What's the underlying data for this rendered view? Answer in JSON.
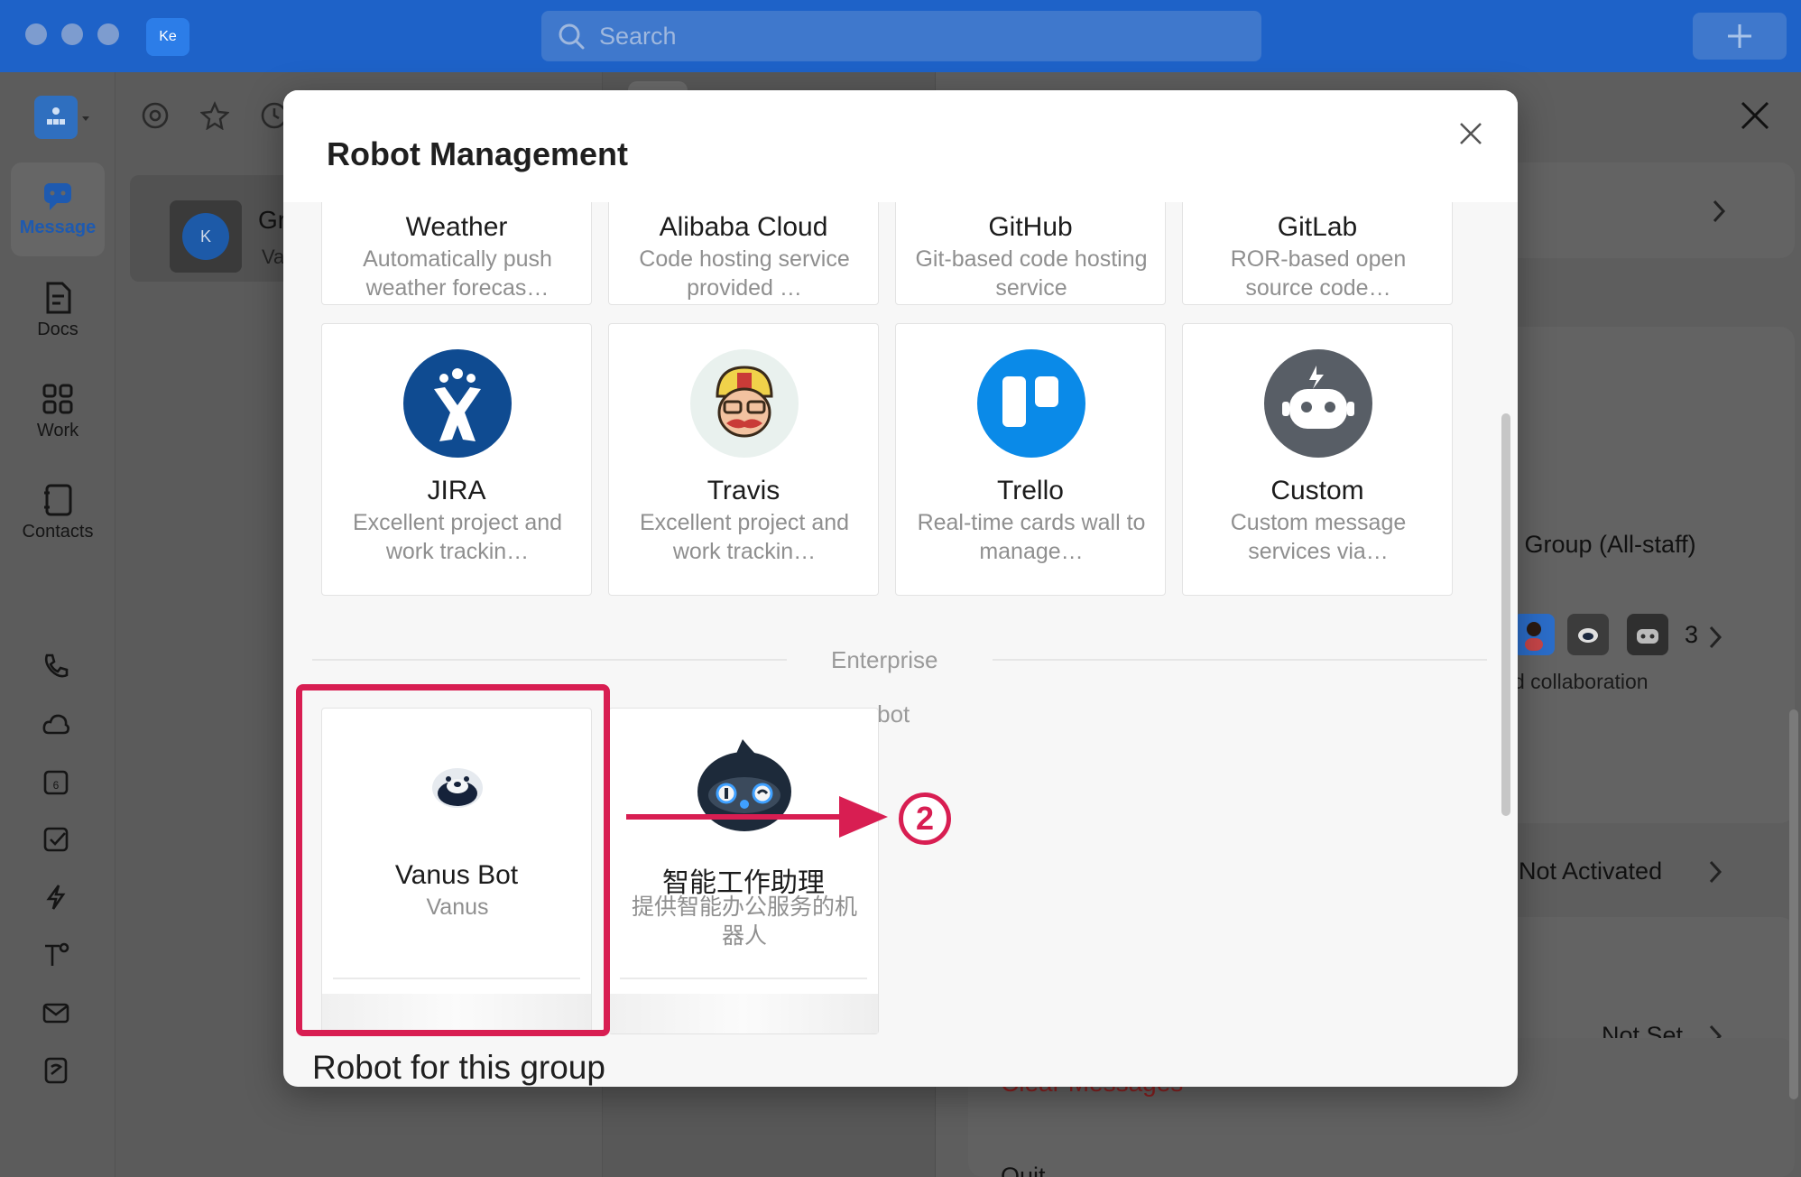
{
  "titlebar": {
    "app_badge": "Ke",
    "search_placeholder": "Search"
  },
  "sidebar": {
    "items": [
      {
        "label": "Message",
        "active": true
      },
      {
        "label": "Docs"
      },
      {
        "label": "Work"
      },
      {
        "label": "Contacts"
      }
    ],
    "more_label": "•••"
  },
  "chat_list": {
    "row": {
      "avatar_letter": "K",
      "name": "Gro",
      "subtitle": "Van"
    }
  },
  "right_panel": {
    "group_name": "e Group (All-staff)",
    "member_count": "3",
    "collab_text": "d collaboration",
    "status_not_activated": "Not Activated",
    "status_not_set": "Not Set",
    "clear_messages": "Clear Messages",
    "quit": "Quit"
  },
  "modal": {
    "title": "Robot Management",
    "robot_cards_top": [
      {
        "name": "Weather",
        "desc": "Automatically push weather forecas…"
      },
      {
        "name": "Alibaba Cloud",
        "desc": "Code hosting service provided …"
      },
      {
        "name": "GitHub",
        "desc": "Git-based code hosting service"
      },
      {
        "name": "GitLab",
        "desc": "ROR-based open source code…"
      }
    ],
    "robot_cards": [
      {
        "name": "JIRA",
        "desc": "Excellent project and work trackin…",
        "icon": "jira-icon",
        "color": "#0f4b91"
      },
      {
        "name": "Travis",
        "desc": "Excellent project and work trackin…",
        "icon": "travis-icon",
        "color": "#e9f1ee"
      },
      {
        "name": "Trello",
        "desc": "Real-time cards wall to manage…",
        "icon": "trello-icon",
        "color": "#0a8ae8"
      },
      {
        "name": "Custom",
        "desc": "Custom message services via…",
        "icon": "custom-robot-icon",
        "color": "#585e66"
      }
    ],
    "section_label_line1": "Enterprise",
    "section_label_line2": "robot",
    "enterprise_robots": [
      {
        "name": "Vanus Bot",
        "desc": "Vanus",
        "icon": "otter-icon"
      },
      {
        "name": "智能工作助理",
        "desc": "提供智能办公服务的机器人",
        "icon": "ai-assistant-icon"
      }
    ],
    "robot_group_title": "Robot for this group"
  },
  "annotation": {
    "step_number": "2",
    "highlight_color": "#d81e52"
  }
}
